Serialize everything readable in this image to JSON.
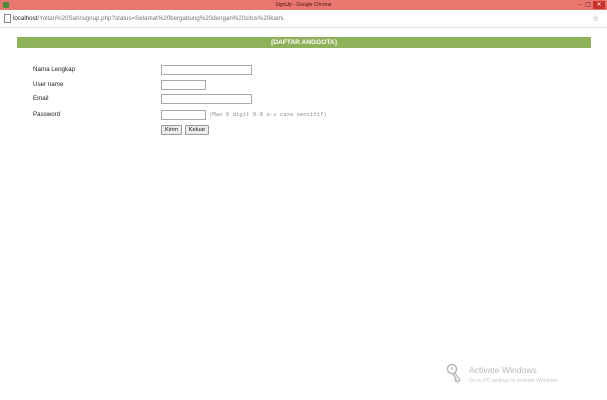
{
  "window": {
    "title": "SignUp - Google Chrome",
    "minimize_glyph": "–",
    "maximize_glyph": "□",
    "close_glyph": "✕",
    "titlebar_color": "#e8786f"
  },
  "address_bar": {
    "url_host": "localhost",
    "url_path": "/Yoltan%20Sari/signup.php?status=Selamat%20bergabung%20dengan%20situs%20kami.",
    "bookmark_glyph": "☆"
  },
  "page": {
    "header": "[DAFTAR ANGGOTA]",
    "header_color": "#8eb25a",
    "form": {
      "nama_label": "Nama Lengkap",
      "nama_value": "",
      "username_label": "User name",
      "username_value": "",
      "email_label": "Email",
      "email_value": "",
      "password_label": "Password",
      "password_value": "",
      "password_hint": "(Max 6 digit 0-9 a-z case sensitif)",
      "submit_label": "Kirim",
      "exit_label": "Keluar"
    }
  },
  "watermark": {
    "title": "Activate Windows",
    "subtitle": "Go to PC settings to activate Windows.",
    "icon": "key-icon"
  }
}
